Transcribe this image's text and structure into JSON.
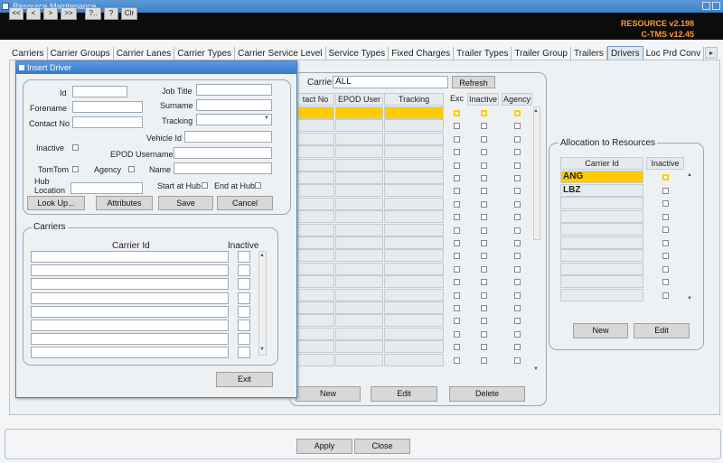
{
  "window": {
    "title": "Resource Maintenance"
  },
  "toolbar": {
    "buttons": [
      "<<",
      "<",
      ">",
      ">>",
      "?..",
      "?",
      "Clr"
    ],
    "version": "RESOURCE v2.198",
    "version2": "C-TMS v12.45"
  },
  "tabs": [
    "Carriers",
    "Carrier Groups",
    "Carrier Lanes",
    "Carrier Types",
    "Carrier Service Level",
    "Service Types",
    "Fixed Charges",
    "Trailer Types",
    "Trailer Group",
    "Trailers",
    "Drivers",
    "Loc Prd Conv"
  ],
  "active_tab": "Drivers",
  "drivers": {
    "carrier_label": "Carrier",
    "carrier_value": "ALL",
    "refresh": "Refresh",
    "columns": [
      "tact No",
      "EPOD User",
      "Tracking",
      "Exc",
      "Inactive",
      "Agency"
    ],
    "new": "New",
    "edit": "Edit",
    "delete": "Delete"
  },
  "allocation": {
    "title": "Allocation to Resources",
    "col1": "Carrier Id",
    "col2": "Inactive",
    "rows": [
      "ANG",
      "LBZ"
    ],
    "new": "New",
    "edit": "Edit"
  },
  "dialog": {
    "title": "Insert Driver",
    "id": "Id",
    "job_title": "Job Title",
    "forename": "Forename",
    "surname": "Surname",
    "contact_no": "Contact No",
    "tracking": "Tracking",
    "vehicle_id": "Vehicle Id",
    "inactive": "Inactive",
    "epod_username": "EPOD Username",
    "tomtom": "TomTom",
    "agency": "Agency",
    "name": "Name",
    "hub_location": "Hub Location",
    "start_at_hub": "Start at Hub",
    "end_at_hub": "End at Hub",
    "look_up": "Look Up...",
    "attributes": "Attributes",
    "save": "Save",
    "cancel": "Cancel",
    "carriers_title": "Carriers",
    "carrier_id": "Carrier Id",
    "carrier_inactive": "Inactive",
    "exit": "Exit"
  },
  "footer": {
    "apply": "Apply",
    "close": "Close"
  }
}
